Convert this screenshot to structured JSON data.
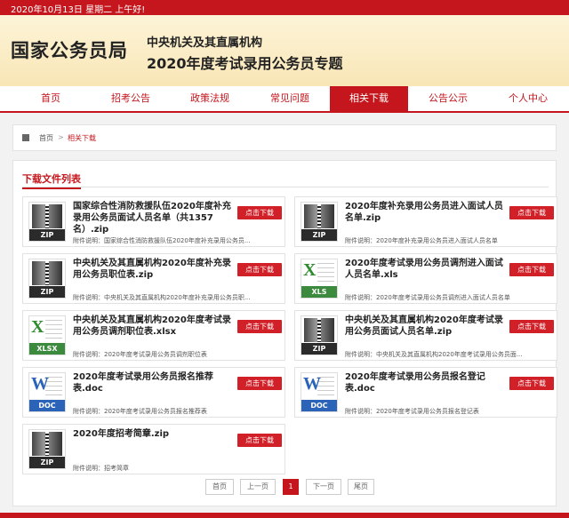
{
  "topbar": {
    "date_text": "2020年10月13日  星期二  上午好!"
  },
  "header": {
    "logo": "国家公务员局",
    "subtitle_1": "中央机关及其直属机构",
    "subtitle_2": "2020年度考试录用公务员专题"
  },
  "nav": {
    "items": [
      {
        "label": "首页"
      },
      {
        "label": "招考公告"
      },
      {
        "label": "政策法规"
      },
      {
        "label": "常见问题"
      },
      {
        "label": "相关下载"
      },
      {
        "label": "公告公示"
      },
      {
        "label": "个人中心"
      }
    ],
    "active_index": 4
  },
  "breadcrumb": {
    "home": "首页",
    "separator": ">",
    "current": "相关下载"
  },
  "section": {
    "title": "下载文件列表"
  },
  "download_label": "点击下载",
  "files": [
    {
      "type": "ZIP",
      "title": "国家综合性消防救援队伍2020年度补充录用公务员面试人员名单（共1357名）.zip",
      "desc": "附件说明：国家综合性消防救援队伍2020年度补充录用公务员..."
    },
    {
      "type": "ZIP",
      "title": "2020年度补充录用公务员进入面试人员名单.zip",
      "desc": "附件说明：2020年度补充录用公务员进入面试人员名单"
    },
    {
      "type": "ZIP",
      "title": "中央机关及其直属机构2020年度补充录用公务员职位表.zip",
      "desc": "附件说明：中央机关及其直属机构2020年度补充录用公务员职..."
    },
    {
      "type": "XLS",
      "title": "2020年度考试录用公务员调剂进入面试人员名单.xls",
      "desc": "附件说明：2020年度考试录用公务员调剂进入面试人员名单"
    },
    {
      "type": "XLSX",
      "title": "中央机关及其直属机构2020年度考试录用公务员调剂职位表.xlsx",
      "desc": "附件说明：2020年度考试录用公务员调剂职位表"
    },
    {
      "type": "ZIP",
      "title": "中央机关及其直属机构2020年度考试录用公务员面试人员名单.zip",
      "desc": "附件说明：中央机关及其直属机构2020年度考试录用公务员面..."
    },
    {
      "type": "DOC",
      "title": "2020年度考试录用公务员报名推荐表.doc",
      "desc": "附件说明：2020年度考试录用公务员报名推荐表"
    },
    {
      "type": "DOC",
      "title": "2020年度考试录用公务员报名登记表.doc",
      "desc": "附件说明：2020年度考试录用公务员报名登记表"
    },
    {
      "type": "ZIP",
      "title": "2020年度招考简章.zip",
      "desc": "附件说明：招考简章"
    }
  ],
  "pagination": {
    "first": "首页",
    "prev": "上一页",
    "current": "1",
    "next": "下一页",
    "last": "尾页"
  },
  "colors": {
    "brand_red": "#c4161c",
    "button_red": "#d12027",
    "header_bg": "#fbeec8"
  }
}
